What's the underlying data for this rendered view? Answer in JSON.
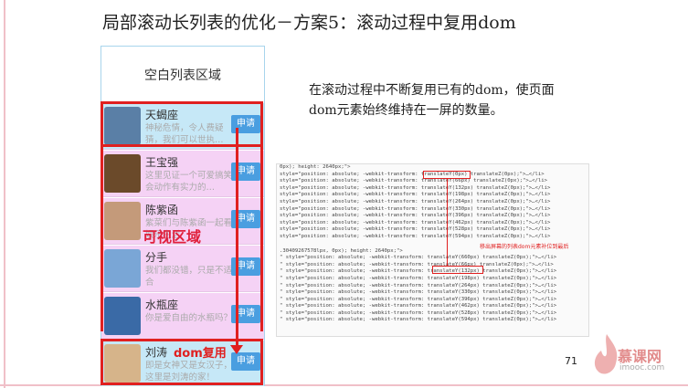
{
  "slide": {
    "title": "局部滚动长列表的优化－方案5：滚动过程中复用dom",
    "note": "在滚动过程中不断复用已有的dom，使页面dom元素始终维持在一屏的数量。",
    "page_number": "71"
  },
  "phone": {
    "blank_label": "空白列表区域",
    "visible_label": "可视区域",
    "reuse_label": "dom复用",
    "items": [
      {
        "name": "天蝎座",
        "desc": "神秘危情，令人费疑猜，我们可以世执…",
        "button": "申请",
        "bg": "#c6e8f7",
        "avatar": "#5a7fa6"
      },
      {
        "name": "王宝强",
        "desc": "这里见证一个可爱搞笑会动作有实力的…",
        "button": "申请",
        "bg": "#f5d2f5",
        "avatar": "#6b4a2a"
      },
      {
        "name": "陈紫函",
        "desc": "紫菜们与陈紫函一起看娱乐生活",
        "button": "申请",
        "bg": "#f5d2f5",
        "avatar": "#c49a7a"
      },
      {
        "name": "分手",
        "desc": "我们都没错，只是不适合",
        "button": "申请",
        "bg": "#f5d2f5",
        "avatar": "#7aa6d6"
      },
      {
        "name": "水瓶座",
        "desc": "你是爱自由的水瓶吗？",
        "button": "申请",
        "bg": "#f5d2f5",
        "avatar": "#3a6aa6"
      },
      {
        "name": "刘涛",
        "desc": "即是女神又是女汉子，这里是刘涛的家！",
        "button": "申请",
        "bg": "#c6e8f7",
        "avatar": "#d6b48a"
      }
    ]
  },
  "code": {
    "block1": [
      "0px); height: 2640px;\">",
      "style=\"position: absolute; -webkit-transform: translateY(0px) translateZ(0px);\">…</li>",
      "style=\"position: absolute; -webkit-transform: translateY(66px) translateZ(0px);\">…</li>",
      "style=\"position: absolute; -webkit-transform: translateY(132px) translateZ(0px);\">…</li>",
      "style=\"position: absolute; -webkit-transform: translateY(198px) translateZ(0px);\">…</li>",
      "style=\"position: absolute; -webkit-transform: translateY(264px) translateZ(0px);\">…</li>",
      "style=\"position: absolute; -webkit-transform: translateY(330px) translateZ(0px);\">…</li>",
      "style=\"position: absolute; -webkit-transform: translateY(396px) translateZ(0px);\">…</li>",
      "style=\"position: absolute; -webkit-transform: translateY(462px) translateZ(0px);\">…</li>",
      "style=\"position: absolute; -webkit-transform: translateY(528px) translateZ(0px);\">…</li>",
      "style=\"position: absolute; -webkit-transform: translateY(594px) translateZ(0px);\">…</li>"
    ],
    "note": "移出屏幕的列表dom元素补位到最后",
    "block2": [
      ".30409267578lpx, 0px); height: 2640px;\">",
      "\" style=\"position: absolute; -webkit-transform: translateY(660px) translateZ(0px);\">…</li>",
      "\" style=\"position: absolute; -webkit-transform: translateY(66px) translateZ(0px);\">…</li>",
      "\" style=\"position: absolute; -webkit-transform: translateY(132px) translateZ(0px);\">…</li>",
      "\" style=\"position: absolute; -webkit-transform: translateY(198px) translateZ(0px);\">…</li>",
      "\" style=\"position: absolute; -webkit-transform: translateY(264px) translateZ(0px);\">…</li>",
      "\" style=\"position: absolute; -webkit-transform: translateY(330px) translateZ(0px);\">…</li>",
      "\" style=\"position: absolute; -webkit-transform: translateY(396px) translateZ(0px);\">…</li>",
      "\" style=\"position: absolute; -webkit-transform: translateY(462px) translateZ(0px);\">…</li>",
      "\" style=\"position: absolute; -webkit-transform: translateY(528px) translateZ(0px);\">…</li>",
      "\" style=\"position: absolute; -webkit-transform: translateY(594px) translateZ(0px);\">…</li>"
    ]
  },
  "logo": {
    "text": "慕课网",
    "sub": "imooc.com",
    "color": "#d04040"
  }
}
